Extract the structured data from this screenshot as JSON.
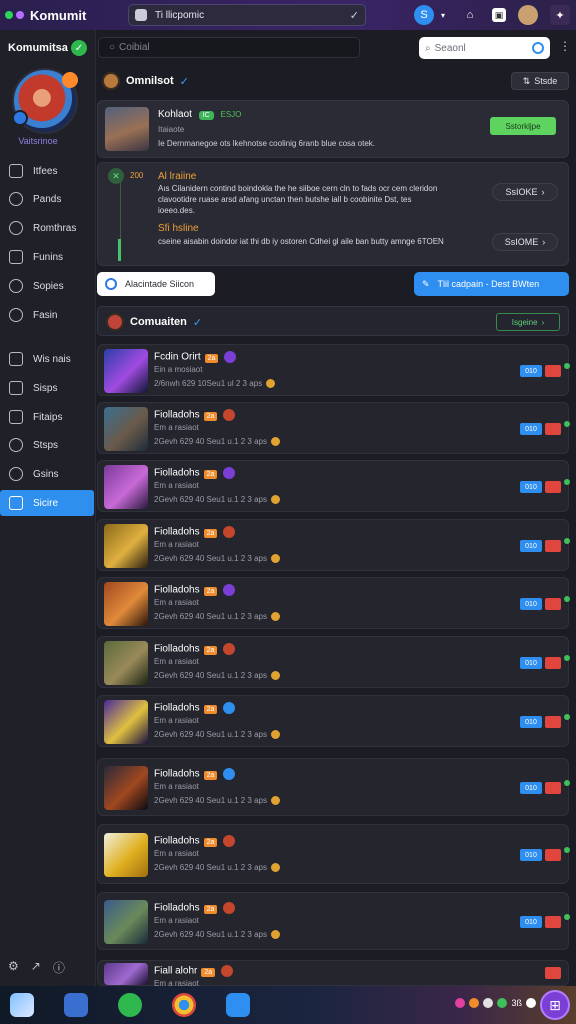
{
  "topbar": {
    "title": "Komumit",
    "url": "Ti llicpomic",
    "colors": {
      "dot1": "#2ed35a",
      "dot2": "#b86bff",
      "bg": "#2a1f4d"
    }
  },
  "sidebar": {
    "brand": "Komumitsa",
    "user_label": "Vaitsrinoe",
    "items": [
      {
        "label": "Itfees",
        "icon": "grid-icon"
      },
      {
        "label": "Pands",
        "icon": "gear-icon"
      },
      {
        "label": "Romthras",
        "icon": "cog-icon"
      },
      {
        "label": "Funins",
        "icon": "folder-icon"
      },
      {
        "label": "Sopies",
        "icon": "clock-icon"
      },
      {
        "label": "Fasin",
        "icon": "search-icon"
      },
      {
        "label": "Wis nais",
        "icon": "chart-icon"
      },
      {
        "label": "Sisps",
        "icon": "box-icon"
      },
      {
        "label": "Fitaips",
        "icon": "filter-icon"
      },
      {
        "label": "Stsps",
        "icon": "settings-icon"
      },
      {
        "label": "Gsins",
        "icon": "star-icon"
      },
      {
        "label": "Sicire",
        "icon": "table-icon",
        "active": true
      }
    ]
  },
  "main": {
    "search_dark_placeholder": "Coibial",
    "search_light_placeholder": "Seaonl",
    "header": {
      "name": "Omnilsot",
      "button": "Stsde"
    },
    "post": {
      "name": "Kohlaot",
      "tag": "IC",
      "num": "ESJO",
      "sub": "Itaiaote",
      "text": "Ie Dernmanegoe ots lkehnotse coolinig 6ranb blue cosa otek.",
      "button": "Sstorkljpe"
    },
    "news": [
      {
        "num": "200",
        "title": "Al lraiine",
        "body": "Aıs Cilanidern contind boindokla the he siiboe cern cln to fads ocr cem cleridon clavootidre ruase arsd afang unctan then butshe iall b coobinite Dst, tes ioeeo.des.",
        "button": "SsIOKE"
      },
      {
        "num": "",
        "title": "Sfi hsline",
        "body": "cseine aisabin doindor iat thi db iy ostoren Cdhei gl aile ban butty amnge 6TOEN",
        "button": "SsIOME"
      }
    ],
    "chip_white": "Alacintade Siicon",
    "button_blue": "Tlil cadpain - Dest BWten",
    "community": {
      "name": "Comuaiten",
      "button": "Isgeine"
    },
    "rows": [
      {
        "name": "Fcdin Orirt",
        "lvl": "2a",
        "sub": "Ein a mosiaot",
        "meta": "2/6nwh 629 10Seu1 ul 2 3 aps",
        "icon_color": "#7b3fd6",
        "thumb": [
          "#2b3fa8",
          "#a04be0",
          "#0e1634"
        ],
        "btn": "010"
      },
      {
        "name": "Fiolladohs",
        "lvl": "2a",
        "sub": "Em a rasiaot",
        "meta": "2Gevh 629 40 Seu1 u.1 2 3 aps",
        "icon_color": "#c4462c",
        "thumb": [
          "#3a6e8f",
          "#6a5a4a",
          "#1c2c3a"
        ],
        "btn": "010"
      },
      {
        "name": "Fiolladohs",
        "lvl": "2a",
        "sub": "Em a rasiaot",
        "meta": "2Gevh 629 40 Seu1 u.1 2 3 aps",
        "icon_color": "#7b3fd6",
        "thumb": [
          "#7a3a9a",
          "#c86ad8",
          "#2a1a3a"
        ],
        "btn": "010"
      },
      {
        "name": "Fiolladohs",
        "lvl": "2a",
        "sub": "Em a rasiaot",
        "meta": "2Gevh 629 40 Seu1 u.1 2 3 aps",
        "icon_color": "#c4462c",
        "thumb": [
          "#8a6a1a",
          "#e0b040",
          "#2a2010"
        ],
        "btn": "010"
      },
      {
        "name": "Fiolladohs",
        "lvl": "2a",
        "sub": "Em a rasiaot",
        "meta": "2Gevh 629 40 Seu1 u.1 2 3 aps",
        "icon_color": "#7b3fd6",
        "thumb": [
          "#a04820",
          "#e08a3a",
          "#2a140a"
        ],
        "btn": "010"
      },
      {
        "name": "Fiolladohs",
        "lvl": "2a",
        "sub": "Em a rasiaot",
        "meta": "2Gevh 629 40 Seu1 u.1 2 3 aps",
        "icon_color": "#c4462c",
        "thumb": [
          "#5a6a3a",
          "#9a8a5a",
          "#1a2414"
        ],
        "btn": "010"
      },
      {
        "name": "Fiolladohs",
        "lvl": "2a",
        "sub": "Em a rasiaot",
        "meta": "2Gevh 629 40 Seu1 u.1 2 3 aps",
        "icon_color": "#2f8ff0",
        "thumb": [
          "#4a2a9a",
          "#e0c040",
          "#1a1040"
        ],
        "btn": "010"
      },
      {
        "name": "Fiolladohs",
        "lvl": "2a",
        "sub": "Em a rasiaot",
        "meta": "2Gevh 629 40 Seu1 u.1 2 3 aps",
        "icon_color": "#2f8ff0",
        "thumb": [
          "#2a2a3a",
          "#a04820",
          "#0a0a10"
        ],
        "btn": "010"
      },
      {
        "name": "Fiolladohs",
        "lvl": "2a",
        "sub": "Em a rasiaot",
        "meta": "2Gevh 629 40 Seu1 u.1 2 3 aps",
        "icon_color": "#c4462c",
        "thumb": [
          "#f0f0e0",
          "#e0b020",
          "#a07010"
        ],
        "btn": "010"
      },
      {
        "name": "Fiolladohs",
        "lvl": "2a",
        "sub": "Em a rasiaot",
        "meta": "2Gevh 629 40 Seu1 u.1 2 3 aps",
        "icon_color": "#c4462c",
        "thumb": [
          "#3a5a8a",
          "#6a8a5a",
          "#1a2a3a"
        ],
        "btn": "010"
      },
      {
        "name": "Fiall alohr",
        "lvl": "2a",
        "sub": "Em a rasiaot",
        "meta": "",
        "icon_color": "#c4462c",
        "thumb": [
          "#5a3a8a",
          "#a06ad0",
          "#1a1030"
        ],
        "btn": ""
      }
    ]
  },
  "taskbar": {
    "tray_text": "3ß",
    "apps": [
      "windows-icon",
      "files-icon",
      "chat-icon",
      "chrome-icon",
      "store-icon"
    ]
  }
}
